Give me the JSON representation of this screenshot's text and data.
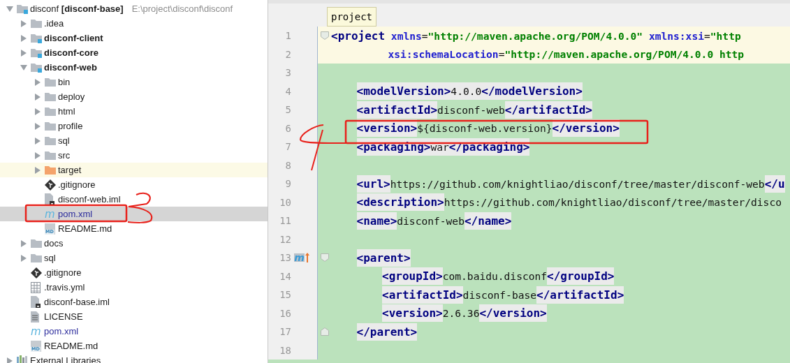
{
  "project_tree": {
    "items": [
      {
        "label": "disconf **[disconf-base]**",
        "path": "E:\\project\\disconf\\disconf",
        "kind": "project",
        "expanded": true,
        "selected": false,
        "children": [
          {
            "label": ".idea",
            "kind": "folder",
            "expanded": false,
            "selected": false
          },
          {
            "label": "disconf-client",
            "kind": "module",
            "expanded": false,
            "selected": false
          },
          {
            "label": "disconf-core",
            "kind": "module",
            "expanded": false,
            "selected": false
          },
          {
            "label": "disconf-web",
            "kind": "module",
            "expanded": true,
            "selected": false,
            "children": [
              {
                "label": "bin",
                "kind": "folder",
                "expanded": false,
                "selected": false
              },
              {
                "label": "deploy",
                "kind": "folder",
                "expanded": false,
                "selected": false
              },
              {
                "label": "html",
                "kind": "folder",
                "expanded": false,
                "selected": false
              },
              {
                "label": "profile",
                "kind": "folder",
                "expanded": false,
                "selected": false
              },
              {
                "label": "sql",
                "kind": "folder",
                "expanded": false,
                "selected": false
              },
              {
                "label": "src",
                "kind": "folder",
                "expanded": false,
                "selected": false
              },
              {
                "label": "target",
                "kind": "excluded",
                "expanded": false,
                "selected": false
              },
              {
                "label": ".gitignore",
                "kind": "git",
                "selected": false
              },
              {
                "label": "disconf-web.iml",
                "kind": "iml",
                "selected": false
              },
              {
                "label": "pom.xml",
                "kind": "maven",
                "glyph": "m",
                "selected": true
              },
              {
                "label": "README.md",
                "kind": "markdown",
                "glyph": "MD",
                "selected": false
              }
            ]
          },
          {
            "label": "docs",
            "kind": "folder",
            "expanded": false,
            "selected": false
          },
          {
            "label": "sql",
            "kind": "folder",
            "expanded": false,
            "selected": false
          },
          {
            "label": ".gitignore",
            "kind": "git",
            "selected": false
          },
          {
            "label": ".travis.yml",
            "kind": "table",
            "selected": false
          },
          {
            "label": "disconf-base.iml",
            "kind": "iml",
            "selected": false
          },
          {
            "label": "LICENSE",
            "kind": "text",
            "selected": false
          },
          {
            "label": "pom.xml",
            "kind": "maven",
            "glyph": "m",
            "selected": false
          },
          {
            "label": "README.md",
            "kind": "markdown",
            "glyph": "MD",
            "selected": false
          }
        ]
      },
      {
        "label": "External Libraries",
        "kind": "libraries",
        "expanded": false,
        "selected": false
      }
    ]
  },
  "editor": {
    "breadcrumb": "project",
    "lines": [
      {
        "number": "1",
        "current": true,
        "fold_start": true,
        "tokens": [
          {
            "kind": "tag",
            "text": "<project"
          },
          {
            "kind": "attr",
            "text": " xmlns"
          },
          {
            "kind": "plain",
            "text": "="
          },
          {
            "kind": "value",
            "text": "\"http://maven.apache.org/POM/4.0.0\""
          },
          {
            "kind": "attr",
            "text": " xmlns:xsi"
          },
          {
            "kind": "plain",
            "text": "="
          },
          {
            "kind": "value",
            "text": "\"http"
          }
        ],
        "children": [
          {
            "number": "2",
            "current": true,
            "continuation": true,
            "tokens": [
              {
                "kind": "attr",
                "text": "xsi:schemaLocation"
              },
              {
                "kind": "plain",
                "text": "="
              },
              {
                "kind": "value",
                "text": "\"http://maven.apache.org/POM/4.0.0 http"
              }
            ]
          },
          {
            "number": "3",
            "current": false
          },
          {
            "number": "4",
            "current": false,
            "tokens": [
              {
                "kind": "tag",
                "text": "<modelVersion>"
              },
              {
                "kind": "shaded",
                "text": "4.0.0"
              },
              {
                "kind": "tag",
                "text": "</modelVersion>"
              }
            ]
          },
          {
            "number": "5",
            "current": false,
            "tokens": [
              {
                "kind": "tag",
                "text": "<artifactId>"
              },
              {
                "kind": "plain",
                "text": "disconf-web"
              },
              {
                "kind": "tag",
                "text": "</artifactId>"
              }
            ]
          },
          {
            "number": "6",
            "current": false,
            "tokens": [
              {
                "kind": "tag",
                "text": "<version>"
              },
              {
                "kind": "plain",
                "text": "${disconf-web.version}"
              },
              {
                "kind": "tag",
                "text": "</version>"
              }
            ]
          },
          {
            "number": "7",
            "current": false,
            "tokens": [
              {
                "kind": "tag",
                "text": "<packaging>"
              },
              {
                "kind": "shaded",
                "text": "war"
              },
              {
                "kind": "tag",
                "text": "</packaging>"
              }
            ]
          },
          {
            "number": "8",
            "current": false
          },
          {
            "number": "9",
            "current": false,
            "tokens": [
              {
                "kind": "tag",
                "text": "<url>"
              },
              {
                "kind": "plain",
                "text": "https://github.com/knightliao/disconf/tree/master/disconf-web"
              },
              {
                "kind": "tag",
                "text": "</u"
              }
            ]
          },
          {
            "number": "10",
            "current": false,
            "tokens": [
              {
                "kind": "tag",
                "text": "<description>"
              },
              {
                "kind": "plain",
                "text": "https://github.com/knightliao/disconf/tree/master/disco"
              }
            ]
          },
          {
            "number": "11",
            "current": false,
            "tokens": [
              {
                "kind": "tag",
                "text": "<name>"
              },
              {
                "kind": "plain",
                "text": "disconf-web"
              },
              {
                "kind": "tag",
                "text": "</name>"
              }
            ]
          },
          {
            "number": "12",
            "current": false
          },
          {
            "number": "13",
            "current": false,
            "fold_start": true,
            "parent_link": true,
            "glyph": "m",
            "tokens": [
              {
                "kind": "tag",
                "text": "<parent>"
              }
            ],
            "children": [
              {
                "number": "14",
                "current": false,
                "tokens": [
                  {
                    "kind": "tag",
                    "text": "<groupId>"
                  },
                  {
                    "kind": "plain",
                    "text": "com.baidu.disconf"
                  },
                  {
                    "kind": "tag",
                    "text": "</groupId>"
                  }
                ]
              },
              {
                "number": "15",
                "current": false,
                "tokens": [
                  {
                    "kind": "tag",
                    "text": "<artifactId>"
                  },
                  {
                    "kind": "plain",
                    "text": "disconf-base"
                  },
                  {
                    "kind": "tag",
                    "text": "</artifactId>"
                  }
                ]
              },
              {
                "number": "16",
                "current": false,
                "tokens": [
                  {
                    "kind": "tag",
                    "text": "<version>"
                  },
                  {
                    "kind": "plain",
                    "text": "2.6.36"
                  },
                  {
                    "kind": "tag",
                    "text": "</version>"
                  }
                ]
              }
            ]
          },
          {
            "number": "17",
            "current": false,
            "fold_end": true,
            "tokens": [
              {
                "kind": "tag",
                "text": "</parent>"
              }
            ]
          },
          {
            "number": "18",
            "current": false
          }
        ]
      }
    ]
  }
}
